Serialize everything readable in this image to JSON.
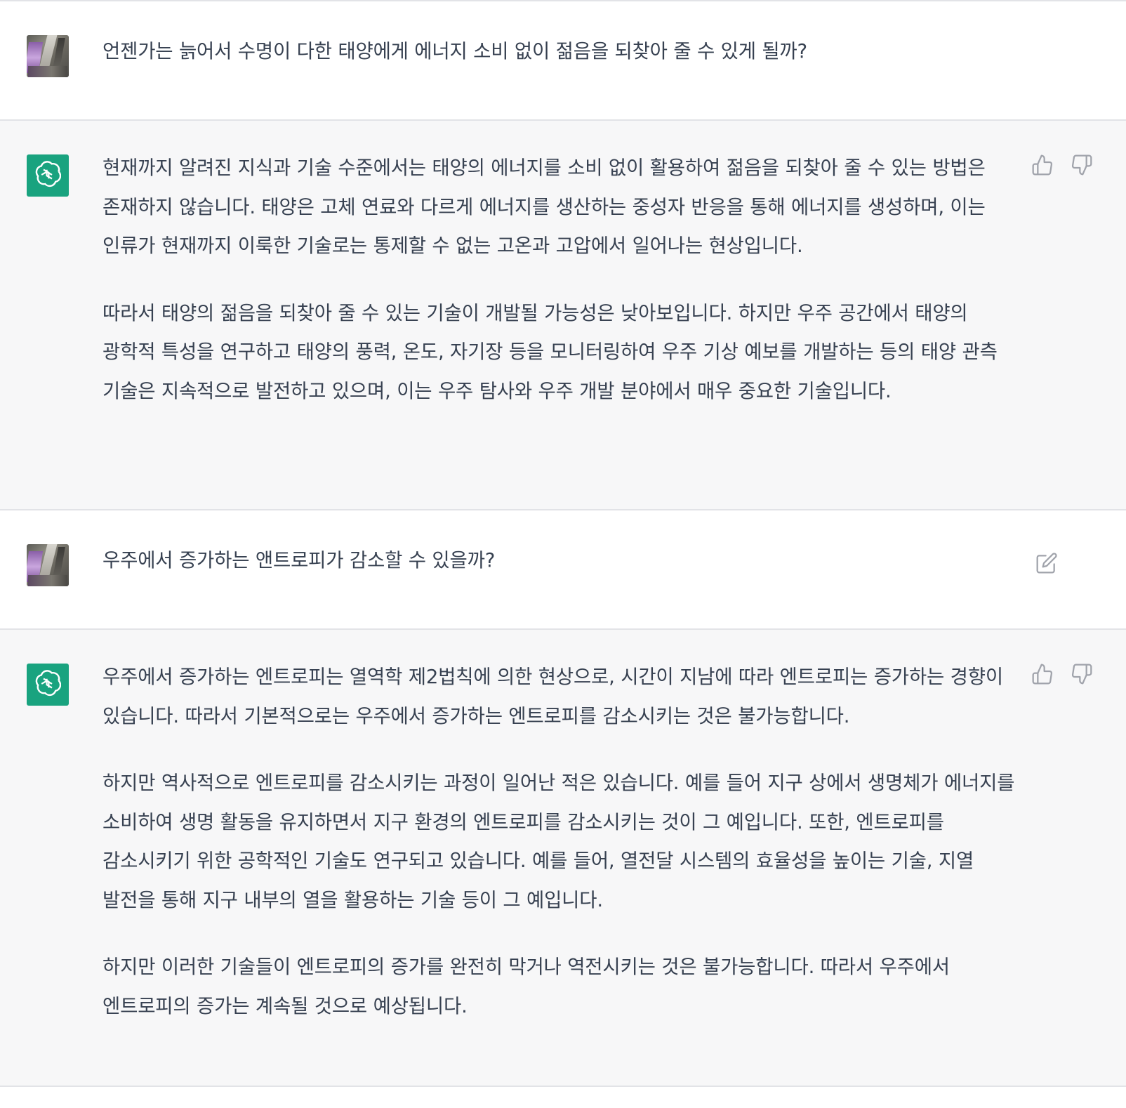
{
  "messages": [
    {
      "role": "user",
      "avatar_icon": "user-photo-avatar",
      "text": "언젠가는 늙어서 수명이 다한 태양에게 에너지 소비 없이 젊음을 되찾아 줄 수 있게 될까?"
    },
    {
      "role": "assistant",
      "avatar_icon": "openai-logo-icon",
      "paragraphs": [
        "현재까지 알려진 지식과 기술 수준에서는 태양의 에너지를 소비 없이 활용하여 젊음을 되찾아 줄 수 있는 방법은 존재하지 않습니다. 태양은 고체 연료와 다르게 에너지를 생산하는 중성자 반응을 통해 에너지를 생성하며, 이는 인류가 현재까지 이룩한 기술로는 통제할 수 없는 고온과 고압에서 일어나는 현상입니다.",
        "따라서 태양의 젊음을 되찾아 줄 수 있는 기술이 개발될 가능성은 낮아보입니다. 하지만 우주 공간에서 태양의 광학적 특성을 연구하고 태양의 풍력, 온도, 자기장 등을 모니터링하여 우주 기상 예보를 개발하는 등의 태양 관측 기술은 지속적으로 발전하고 있으며, 이는 우주 탐사와 우주 개발 분야에서 매우 중요한 기술입니다."
      ]
    },
    {
      "role": "user",
      "avatar_icon": "user-photo-avatar",
      "text": "우주에서 증가하는 앤트로피가 감소할 수 있을까?"
    },
    {
      "role": "assistant",
      "avatar_icon": "openai-logo-icon",
      "paragraphs": [
        "우주에서 증가하는 엔트로피는 열역학 제2법칙에 의한 현상으로, 시간이 지남에 따라 엔트로피는 증가하는 경향이 있습니다. 따라서 기본적으로는 우주에서 증가하는 엔트로피를 감소시키는 것은 불가능합니다.",
        "하지만 역사적으로 엔트로피를 감소시키는 과정이 일어난 적은 있습니다. 예를 들어 지구 상에서 생명체가 에너지를 소비하여 생명 활동을 유지하면서 지구 환경의 엔트로피를 감소시키는 것이 그 예입니다. 또한, 엔트로피를 감소시키기 위한 공학적인 기술도 연구되고 있습니다. 예를 들어, 열전달 시스템의 효율성을 높이는 기술, 지열 발전을 통해 지구 내부의 열을 활용하는 기술 등이 그 예입니다.",
        "하지만 이러한 기술들이 엔트로피의 증가를 완전히 막거나 역전시키는 것은 불가능합니다. 따라서 우주에서 엔트로피의 증가는 계속될 것으로 예상됩니다."
      ]
    }
  ],
  "icons": {
    "thumbs_up": "thumbs-up-icon",
    "thumbs_down": "thumbs-down-icon",
    "edit": "edit-icon"
  },
  "colors": {
    "assistant_bg": "#f7f7f8",
    "user_bg": "#ffffff",
    "bot_avatar": "#19a37f",
    "text": "#374151",
    "icon": "#a0a3ab",
    "divider": "#e2e3e7"
  }
}
